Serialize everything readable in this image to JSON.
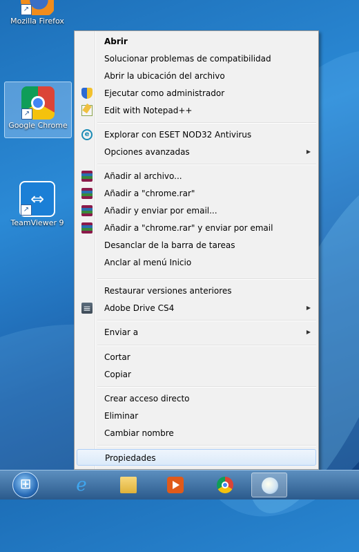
{
  "desktop": {
    "icons": [
      {
        "label": "Mozilla Firefox"
      },
      {
        "label": "Google Chrome"
      },
      {
        "label": "TeamViewer 9"
      }
    ]
  },
  "context_menu": {
    "items": [
      {
        "label": "Abrir",
        "bold": true,
        "icon": null
      },
      {
        "label": "Solucionar problemas de compatibilidad",
        "icon": null
      },
      {
        "label": "Abrir la ubicación del archivo",
        "icon": null
      },
      {
        "label": "Ejecutar como administrador",
        "icon": "uac-shield-icon"
      },
      {
        "label": "Edit with Notepad++",
        "icon": "notepad-plus-plus-icon"
      },
      {
        "label": "Explorar con ESET NOD32 Antivirus",
        "icon": "eset-icon"
      },
      {
        "label": "Opciones avanzadas",
        "submenu": true
      },
      {
        "label": "Añadir al archivo...",
        "icon": "winrar-icon"
      },
      {
        "label": "Añadir a \"chrome.rar\"",
        "icon": "winrar-icon"
      },
      {
        "label": "Añadir y enviar por email...",
        "icon": "winrar-icon"
      },
      {
        "label": "Añadir a \"chrome.rar\" y enviar por email",
        "icon": "winrar-icon"
      },
      {
        "label": "Desanclar de la barra de tareas"
      },
      {
        "label": "Anclar al menú Inicio"
      },
      {
        "label": "Restaurar versiones anteriores"
      },
      {
        "label": "Adobe Drive CS4",
        "icon": "adobe-drive-icon",
        "submenu": true
      },
      {
        "label": "Enviar a",
        "submenu": true
      },
      {
        "label": "Cortar"
      },
      {
        "label": "Copiar"
      },
      {
        "label": "Crear acceso directo"
      },
      {
        "label": "Eliminar"
      },
      {
        "label": "Cambiar nombre"
      },
      {
        "label": "Propiedades",
        "highlighted": true
      }
    ],
    "submenu_arrow": "▶"
  },
  "taskbar": {
    "items": [
      {
        "icon": "internet-explorer-icon"
      },
      {
        "icon": "file-explorer-icon"
      },
      {
        "icon": "media-player-icon"
      },
      {
        "icon": "chrome-icon"
      },
      {
        "icon": "paint-icon",
        "active": true
      }
    ]
  }
}
